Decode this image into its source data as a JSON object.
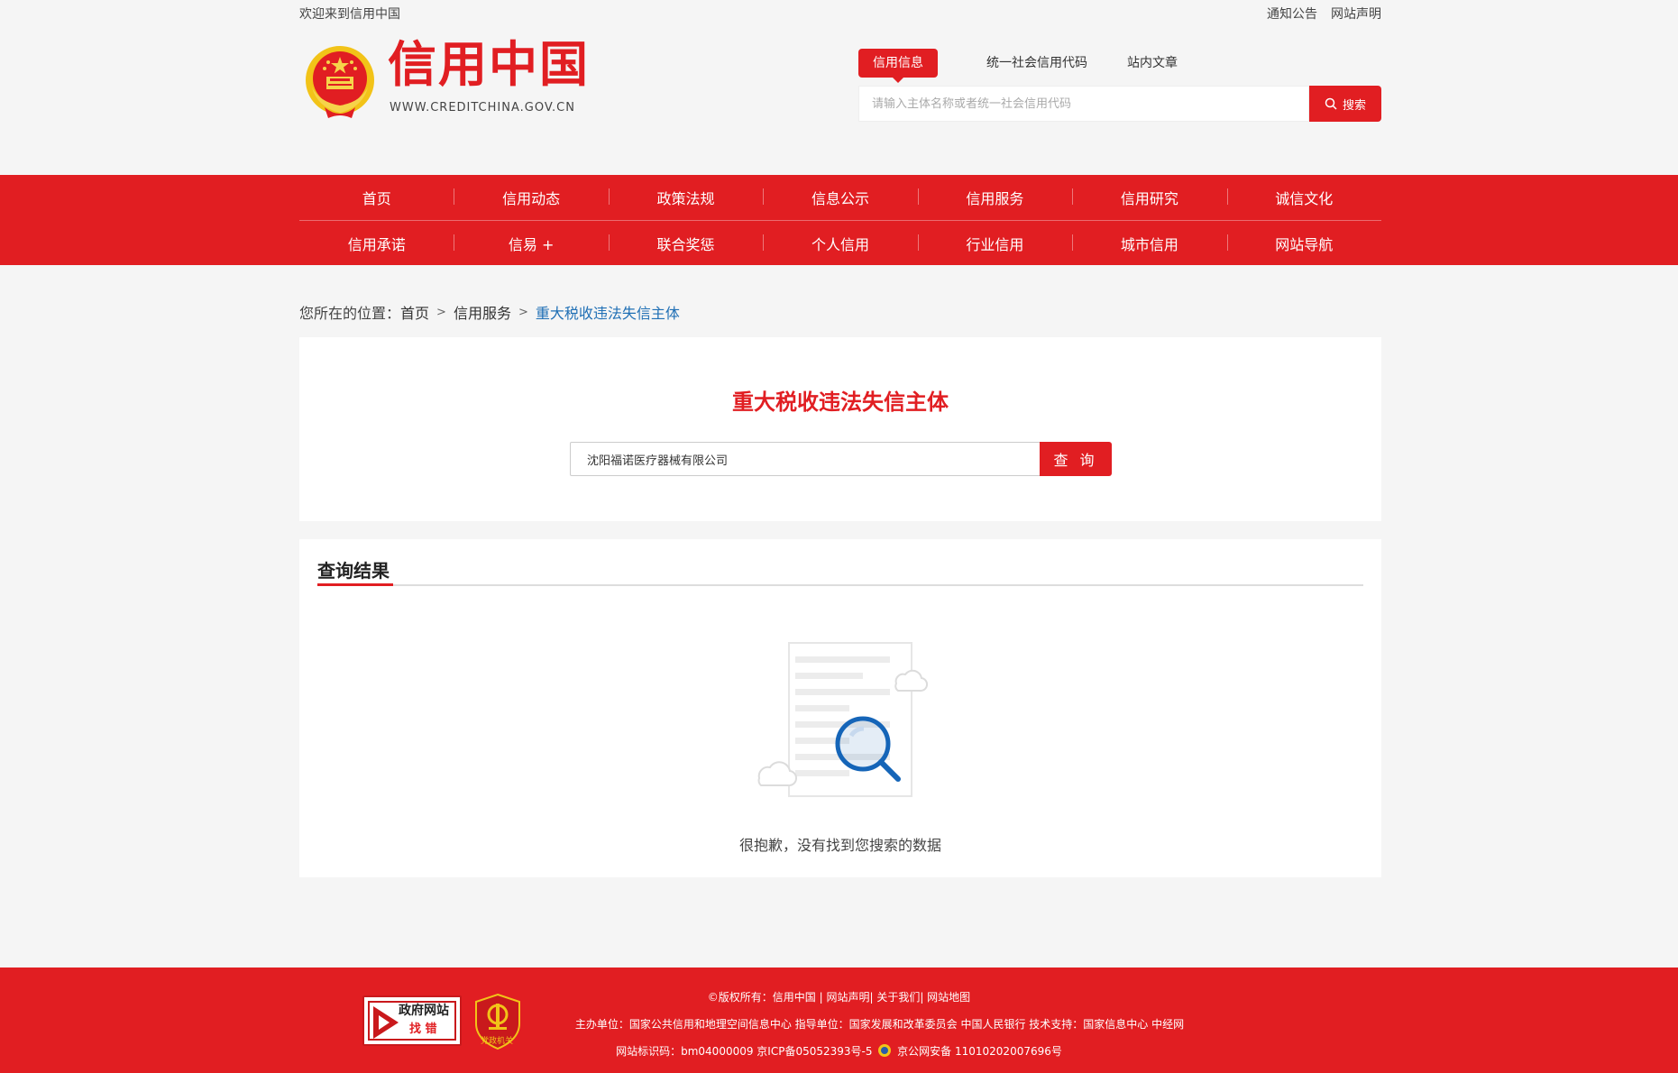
{
  "topbar": {
    "welcome": "欢迎来到信用中国",
    "links": [
      "通知公告",
      "网站声明"
    ]
  },
  "header": {
    "logo_title": "信用中国",
    "logo_sub": "WWW.CREDITCHINA.GOV.CN",
    "search_tabs": [
      "信用信息",
      "统一社会信用代码",
      "站内文章"
    ],
    "search_placeholder": "请输入主体名称或者统一社会信用代码",
    "search_button": "搜索"
  },
  "nav": {
    "row1": [
      "首页",
      "信用动态",
      "政策法规",
      "信息公示",
      "信用服务",
      "信用研究",
      "诚信文化"
    ],
    "row2": [
      "信用承诺",
      "信易 +",
      "联合奖惩",
      "个人信用",
      "行业信用",
      "城市信用",
      "网站导航"
    ]
  },
  "breadcrumb": {
    "prefix": "您所在的位置：",
    "home": "首页",
    "sep": ">",
    "section": "信用服务",
    "current": "重大税收违法失信主体"
  },
  "query": {
    "title": "重大税收违法失信主体",
    "input_value": "沈阳福诺医疗器械有限公司",
    "button": "查 询"
  },
  "results": {
    "heading": "查询结果",
    "empty_text": "很抱歉，没有找到您搜索的数据"
  },
  "footer": {
    "line1": "©版权所有：信用中国 | 网站声明| 关于我们| 网站地图",
    "line2": "主办单位：国家公共信用和地理空间信息中心   指导单位：国家发展和改革委员会 中国人民银行   技术支持：国家信息中心 中经网",
    "line3_a": "网站标识码：bm04000009 京ICP备05052393号-5",
    "line3_b": "京公网安备 11010202007696号",
    "badge_zf_1": "政府网站",
    "badge_zf_2": "找 错",
    "badge_dz": "党政机关"
  },
  "colors": {
    "brand_red": "#e11e22",
    "link_blue": "#1f6fb5"
  }
}
